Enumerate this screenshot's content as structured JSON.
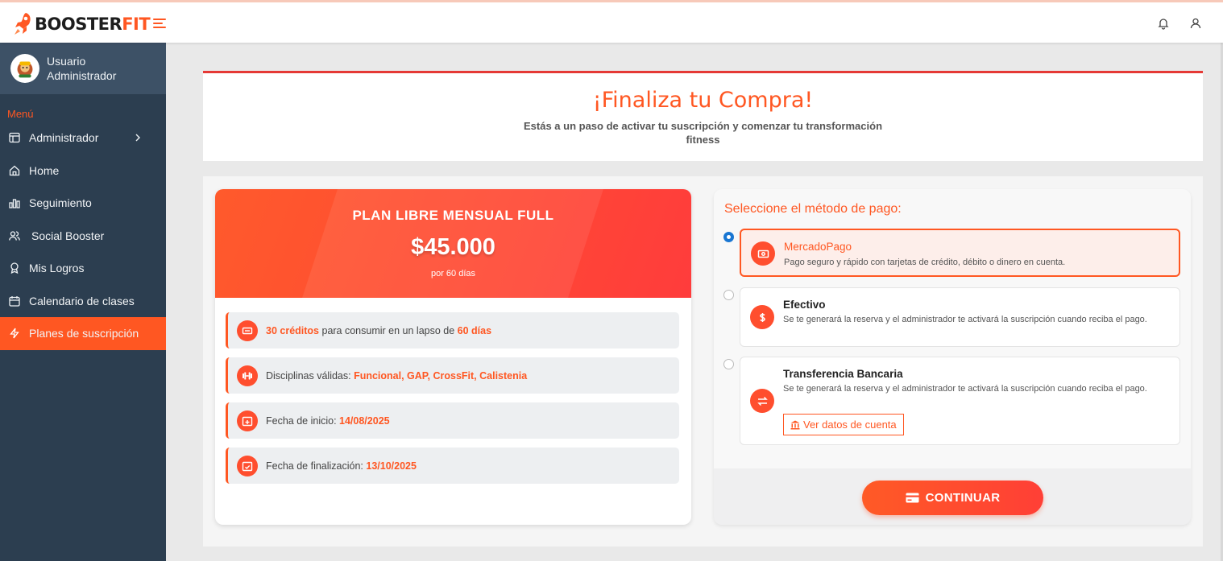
{
  "brand": {
    "part1": "BOOSTER",
    "part2": "FIT",
    "accent": "#ff5722"
  },
  "user": {
    "line1": "Usuario",
    "line2": "Administrador"
  },
  "sidebar": {
    "menu_title": "Menú",
    "items": [
      {
        "label": "Administrador",
        "icon": "layout-icon"
      },
      {
        "label": "Home",
        "icon": "home-icon"
      },
      {
        "label": "Seguimiento",
        "icon": "chart-icon"
      },
      {
        "label": "Social Booster",
        "icon": "users-icon"
      },
      {
        "label": "Mis Logros",
        "icon": "award-icon"
      },
      {
        "label": "Calendario de clases",
        "icon": "calendar-icon"
      },
      {
        "label": "Planes de suscripción",
        "icon": "bolt-icon",
        "active": true
      }
    ]
  },
  "header": {
    "title": "¡Finaliza tu Compra!",
    "subtitle": "Estás a un paso de activar tu suscripción y comenzar tu transformación fitness"
  },
  "plan": {
    "name": "PLAN LIBRE MENSUAL FULL",
    "price": "$45.000",
    "period": "por 60 días",
    "features": {
      "credits_value": "30 créditos",
      "credits_text": " para consumir en un lapso de ",
      "credits_days": "60 días",
      "disciplines_label": "Disciplinas válidas: ",
      "disciplines_value": "Funcional, GAP, CrossFit, Calistenia",
      "start_label": "Fecha de inicio: ",
      "start_value": "14/08/2025",
      "end_label": "Fecha de finalización: ",
      "end_value": "13/10/2025"
    }
  },
  "payment": {
    "title": "Seleccione el método de pago:",
    "options": [
      {
        "title": "MercadoPago",
        "desc": "Pago seguro y rápido con tarjetas de crédito, débito o dinero en cuenta.",
        "selected": true
      },
      {
        "title": "Efectivo",
        "desc": "Se te generará la reserva y el administrador te activará la suscripción cuando reciba el pago.",
        "selected": false
      },
      {
        "title": "Transferencia Bancaria",
        "desc": "Se te generará la reserva y el administrador te activará la suscripción cuando reciba el pago.",
        "selected": false,
        "button": "Ver datos de cuenta"
      }
    ],
    "continue_label": "CONTINUAR"
  }
}
